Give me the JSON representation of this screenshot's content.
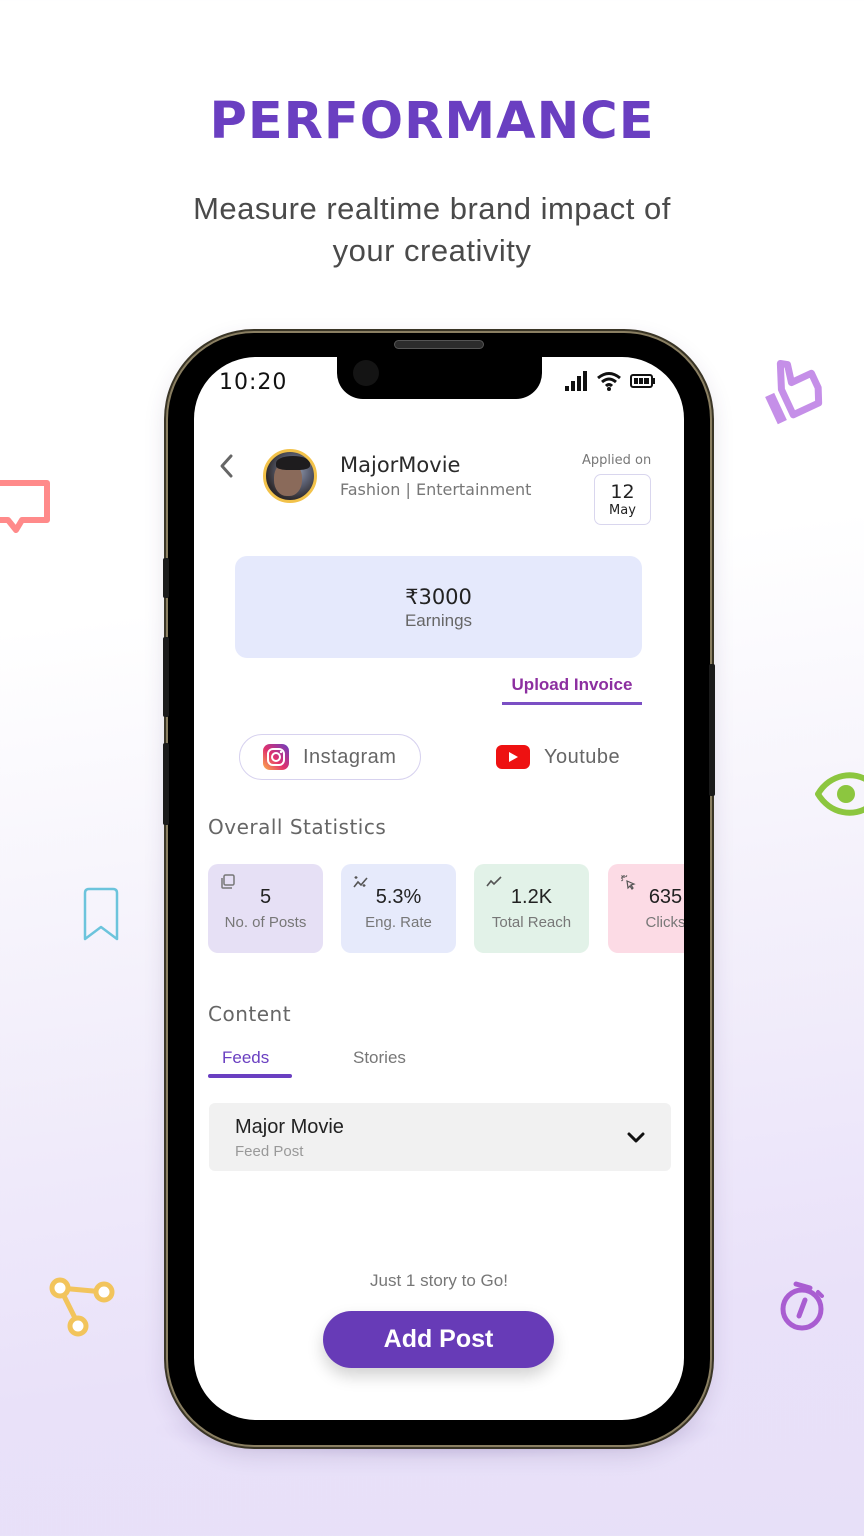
{
  "promo": {
    "headline": "PERFORMANCE",
    "subline_line1": "Measure realtime brand impact of",
    "subline_line2": "your creativity"
  },
  "decorations": [
    {
      "icon": "thumbs-up-icon",
      "color": "#c58fe8"
    },
    {
      "icon": "chat-bubble-icon",
      "color": "#ff8a8a"
    },
    {
      "icon": "eye-icon",
      "color": "#8cc63f"
    },
    {
      "icon": "bookmark-icon",
      "color": "#6cc4dc"
    },
    {
      "icon": "share-nodes-icon",
      "color": "#f2c45c"
    },
    {
      "icon": "stopwatch-icon",
      "color": "#a95dd1"
    }
  ],
  "status_bar": {
    "time": "10:20",
    "icons": [
      "signal-icon",
      "wifi-icon",
      "battery-icon"
    ]
  },
  "header": {
    "back_icon": "chevron-left-icon",
    "brand_name": "MajorMovie",
    "brand_category": "Fashion | Entertainment",
    "applied_label": "Applied on",
    "applied_day": "12",
    "applied_month": "May"
  },
  "earnings": {
    "amount": "₹3000",
    "label": "Earnings",
    "upload_link": "Upload Invoice"
  },
  "platforms": [
    {
      "label": "Instagram",
      "icon": "instagram-icon",
      "active": true
    },
    {
      "label": "Youtube",
      "icon": "youtube-icon",
      "active": false
    }
  ],
  "stats": {
    "title": "Overall Statistics",
    "cards": [
      {
        "value": "5",
        "label": "No. of Posts",
        "icon": "copy-icon",
        "bg": "#e6e0f5"
      },
      {
        "value": "5.3%",
        "label": "Eng. Rate",
        "icon": "sparkle-trend-icon",
        "bg": "#e6eafb"
      },
      {
        "value": "1.2K",
        "label": "Total Reach",
        "icon": "trend-line-icon",
        "bg": "#e2f2e8"
      },
      {
        "value": "635",
        "label": "Clicks",
        "icon": "cursor-click-icon",
        "bg": "#fcdbe5"
      }
    ]
  },
  "content": {
    "title": "Content",
    "tabs": [
      {
        "label": "Feeds",
        "active": true
      },
      {
        "label": "Stories",
        "active": false
      }
    ],
    "posts": [
      {
        "title": "Major Movie",
        "subtitle": "Feed Post"
      }
    ]
  },
  "footer": {
    "note": "Just 1 story to Go!",
    "add_post_label": "Add Post"
  },
  "colors": {
    "accent": "#673bb7",
    "headline": "#6a3fc1",
    "link": "#8c2fa0"
  }
}
